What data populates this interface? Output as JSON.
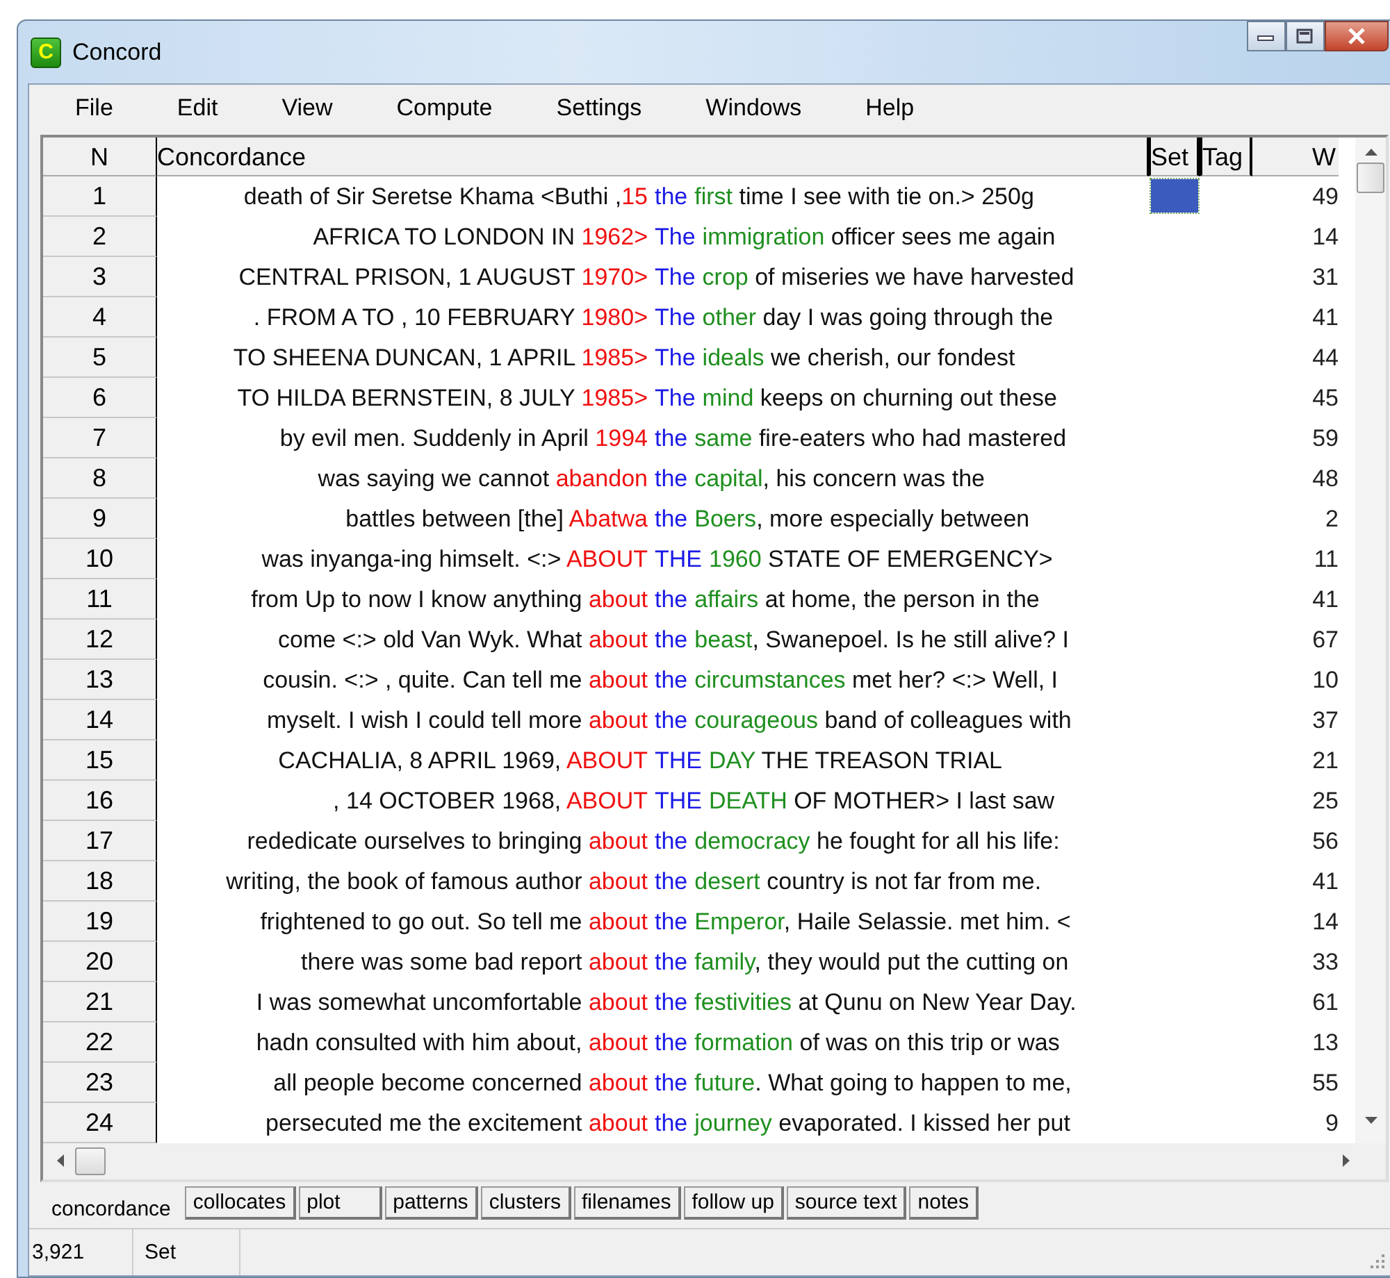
{
  "window": {
    "title": "Concord",
    "icon_letter": "C"
  },
  "menu": [
    "File",
    "Edit",
    "View",
    "Compute",
    "Settings",
    "Windows",
    "Help"
  ],
  "table": {
    "columns": [
      "N",
      "Concordance",
      "Set",
      "Tag",
      "W"
    ],
    "rows": [
      {
        "n": "1",
        "left": "death of Sir Seretse Khama <Buthi ,",
        "l1": "15",
        "node": "the",
        "r1": "first",
        "right": " time I see with tie on.> 250g",
        "set": true,
        "w": "49"
      },
      {
        "n": "2",
        "left": "AFRICA TO LONDON IN ",
        "l1": "1962>",
        "node": "The",
        "r1": "immigration",
        "right": " officer sees me again",
        "set": false,
        "w": "14"
      },
      {
        "n": "3",
        "left": "CENTRAL PRISON, 1 AUGUST ",
        "l1": "1970>",
        "node": "The",
        "r1": "crop",
        "right": " of miseries we have harvested",
        "set": false,
        "w": "31"
      },
      {
        "n": "4",
        "left": ". FROM A TO , 10 FEBRUARY ",
        "l1": "1980>",
        "node": "The",
        "r1": "other",
        "right": " day I was going through the",
        "set": false,
        "w": "41"
      },
      {
        "n": "5",
        "left": "TO SHEENA DUNCAN, 1 APRIL ",
        "l1": "1985>",
        "node": "The",
        "r1": "ideals",
        "right": " we cherish, our fondest",
        "set": false,
        "w": "44"
      },
      {
        "n": "6",
        "left": "TO HILDA BERNSTEIN, 8 JULY ",
        "l1": "1985>",
        "node": "The",
        "r1": "mind",
        "right": " keeps on churning out these",
        "set": false,
        "w": "45"
      },
      {
        "n": "7",
        "left": "by evil men. Suddenly in April ",
        "l1": "1994",
        "node": "the",
        "r1": "same",
        "right": " fire-eaters who had mastered",
        "set": false,
        "w": "59"
      },
      {
        "n": "8",
        "left": "was saying we cannot ",
        "l1": "abandon",
        "node": "the",
        "r1": "capital",
        "right": ", his concern was the",
        "set": false,
        "w": "48"
      },
      {
        "n": "9",
        "left": "battles between [the] ",
        "l1": "Abatwa",
        "node": "the",
        "r1": "Boers",
        "right": ", more especially between",
        "set": false,
        "w": "2"
      },
      {
        "n": "10",
        "left": "was inyanga-ing himselt. <:> ",
        "l1": "ABOUT",
        "node": "THE",
        "r1": "1960",
        "right": " STATE OF EMERGENCY>",
        "set": false,
        "w": "11"
      },
      {
        "n": "11",
        "left": "from Up to now I know anything ",
        "l1": "about",
        "node": "the",
        "r1": "affairs",
        "right": " at home, the person in the",
        "set": false,
        "w": "41"
      },
      {
        "n": "12",
        "left": "come <:> old Van Wyk. What ",
        "l1": "about",
        "node": "the",
        "r1": "beast",
        "right": ", Swanepoel. Is he still alive? I",
        "set": false,
        "w": "67"
      },
      {
        "n": "13",
        "left": "cousin. <:> , quite. Can tell me ",
        "l1": "about",
        "node": "the",
        "r1": "circumstances",
        "right": " met her? <:> Well, I",
        "set": false,
        "w": "10"
      },
      {
        "n": "14",
        "left": "myselt. I wish I could tell more ",
        "l1": "about",
        "node": "the",
        "r1": "courageous",
        "right": " band of colleagues with",
        "set": false,
        "w": "37"
      },
      {
        "n": "15",
        "left": "CACHALIA, 8 APRIL 1969, ",
        "l1": "ABOUT",
        "node": "THE",
        "r1": "DAY",
        "right": " THE TREASON TRIAL",
        "set": false,
        "w": "21"
      },
      {
        "n": "16",
        "left": ", 14 OCTOBER 1968, ",
        "l1": "ABOUT",
        "node": "THE",
        "r1": "DEATH",
        "right": " OF MOTHER> I last saw",
        "set": false,
        "w": "25"
      },
      {
        "n": "17",
        "left": "rededicate ourselves to bringing ",
        "l1": "about",
        "node": "the",
        "r1": "democracy",
        "right": " he fought for all his life:",
        "set": false,
        "w": "56"
      },
      {
        "n": "18",
        "left": "writing, the book of famous author ",
        "l1": "about",
        "node": "the",
        "r1": "desert",
        "right": " country is not far from me.",
        "set": false,
        "w": "41"
      },
      {
        "n": "19",
        "left": "frightened to go out. So tell me ",
        "l1": "about",
        "node": "the",
        "r1": "Emperor",
        "right": ", Haile Selassie. met him. <",
        "set": false,
        "w": "14"
      },
      {
        "n": "20",
        "left": "there was some bad report ",
        "l1": "about",
        "node": "the",
        "r1": "family",
        "right": ", they would put the cutting on",
        "set": false,
        "w": "33"
      },
      {
        "n": "21",
        "left": "I was somewhat uncomfortable ",
        "l1": "about",
        "node": "the",
        "r1": "festivities",
        "right": " at Qunu on New Year Day.",
        "set": false,
        "w": "61"
      },
      {
        "n": "22",
        "left": "hadn consulted with him about, ",
        "l1": "about",
        "node": "the",
        "r1": "formation",
        "right": " of was on this trip or was",
        "set": false,
        "w": "13"
      },
      {
        "n": "23",
        "left": "all people become concerned ",
        "l1": "about",
        "node": "the",
        "r1": "future",
        "right": ". What going to happen to me,",
        "set": false,
        "w": "55"
      },
      {
        "n": "24",
        "left": "persecuted me the excitement ",
        "l1": "about",
        "node": "the",
        "r1": "journey",
        "right": " evaporated. I kissed her put",
        "set": false,
        "w": "9"
      }
    ]
  },
  "tabs": [
    {
      "label": "concordance",
      "selected": true
    },
    {
      "label": "collocates",
      "selected": false
    },
    {
      "label": "plot",
      "selected": false
    },
    {
      "label": "patterns",
      "selected": false
    },
    {
      "label": "clusters",
      "selected": false
    },
    {
      "label": "filenames",
      "selected": false
    },
    {
      "label": "follow up",
      "selected": false
    },
    {
      "label": "source text",
      "selected": false
    },
    {
      "label": "notes",
      "selected": false
    }
  ],
  "status_bar": [
    "3,921",
    "Set"
  ]
}
